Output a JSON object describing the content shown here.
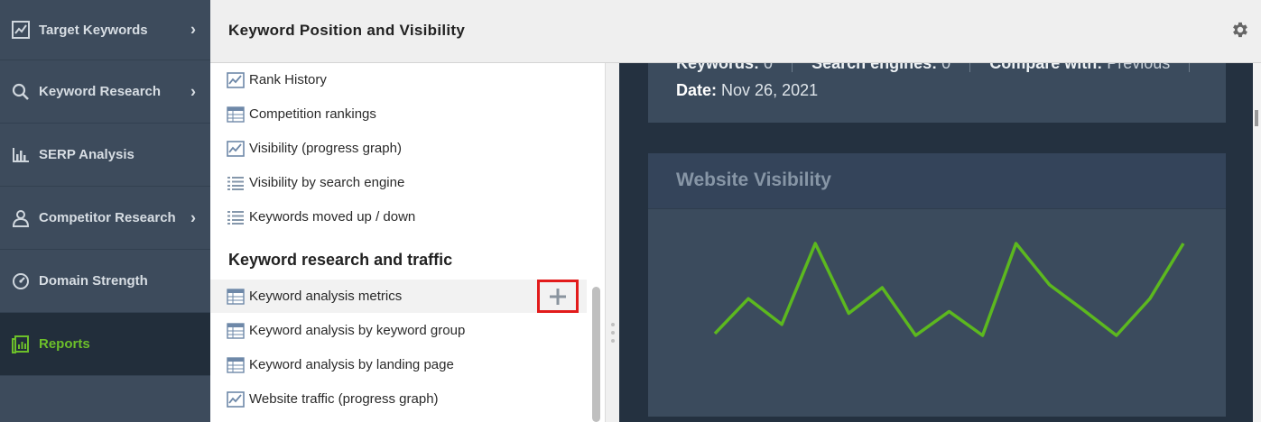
{
  "sidebar": {
    "items": [
      {
        "label": "Target Keywords",
        "icon": "line-chart-icon",
        "has_chevron": true
      },
      {
        "label": "Keyword Research",
        "icon": "search-icon",
        "has_chevron": true
      },
      {
        "label": "SERP Analysis",
        "icon": "bar-chart-icon",
        "has_chevron": false
      },
      {
        "label": "Competitor Research",
        "icon": "user-icon",
        "has_chevron": true
      },
      {
        "label": "Domain Strength",
        "icon": "gauge-icon",
        "has_chevron": false
      },
      {
        "label": "Reports",
        "icon": "reports-icon",
        "has_chevron": false,
        "active": true
      }
    ],
    "chevron": "›"
  },
  "header": {
    "title": "Keyword Position and Visibility",
    "settings_icon": "gear-icon"
  },
  "report_list": {
    "items_top": [
      {
        "label": "Rank History",
        "icon": "line-chart-icon"
      },
      {
        "label": "Competition rankings",
        "icon": "table-icon"
      },
      {
        "label": "Visibility (progress graph)",
        "icon": "line-chart-icon"
      },
      {
        "label": "Visibility by search engine",
        "icon": "list-icon"
      },
      {
        "label": "Keywords moved up / down",
        "icon": "list-icon"
      }
    ],
    "section_title": "Keyword research and traffic",
    "items_bottom": [
      {
        "label": "Keyword analysis metrics",
        "icon": "table-icon",
        "hovered": true
      },
      {
        "label": "Keyword analysis by keyword group",
        "icon": "table-icon"
      },
      {
        "label": "Keyword analysis by landing page",
        "icon": "table-icon"
      },
      {
        "label": "Website traffic (progress graph)",
        "icon": "line-chart-icon"
      }
    ],
    "add_button_icon": "plus-icon"
  },
  "preview": {
    "summary": {
      "keywords_label": "Keywords:",
      "keywords_value": "0",
      "engines_label": "Search engines:",
      "engines_value": "0",
      "compare_label": "Compare with:",
      "compare_value": "Previous",
      "date_label": "Date:",
      "date_value": "Nov 26, 2021"
    },
    "visibility_card": {
      "title": "Website Visibility"
    }
  },
  "chart_data": {
    "type": "line",
    "title": "Website Visibility",
    "xlabel": "",
    "ylabel": "",
    "grid": false,
    "series": [
      {
        "values": [
          2,
          40,
          12,
          100,
          24,
          52,
          0,
          26,
          0,
          100,
          55,
          28,
          0,
          40,
          100
        ]
      }
    ],
    "ylim": [
      0,
      100
    ],
    "colors": {
      "line": "#5cb81f"
    }
  },
  "colors": {
    "accent_green": "#6cbf2a",
    "sidebar_bg": "#3d4b5c",
    "highlight_red": "#e21b1b"
  }
}
